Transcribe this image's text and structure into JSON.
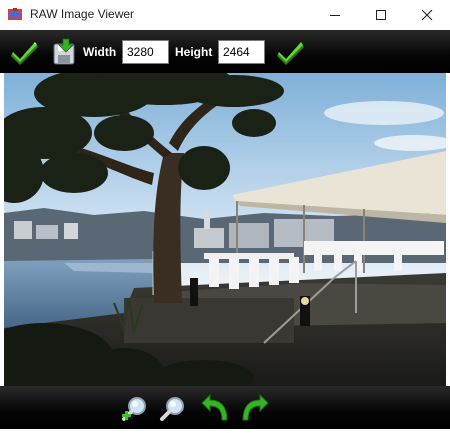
{
  "window": {
    "title": "RAW Image Viewer",
    "app_icon": "raw-viewer-app-icon",
    "controls": [
      "minimize-icon",
      "maximize-icon",
      "close-icon"
    ]
  },
  "toolbar": {
    "apply_icon": "checkmark-icon",
    "save_icon": "save-disk-icon",
    "width_label": "Width",
    "width_value": "3280",
    "height_label": "Height",
    "height_value": "2464",
    "confirm_icon": "checkmark-icon"
  },
  "viewer": {
    "image": "coastal-seaside-photo-with-pine-tree-and-terrace"
  },
  "bottombar": {
    "tools": [
      "zoom-in-icon",
      "zoom-out-icon",
      "rotate-left-icon",
      "rotate-right-icon"
    ]
  },
  "colors": {
    "toolbar_bg": "#000000",
    "check_green": "#3cc81e"
  }
}
